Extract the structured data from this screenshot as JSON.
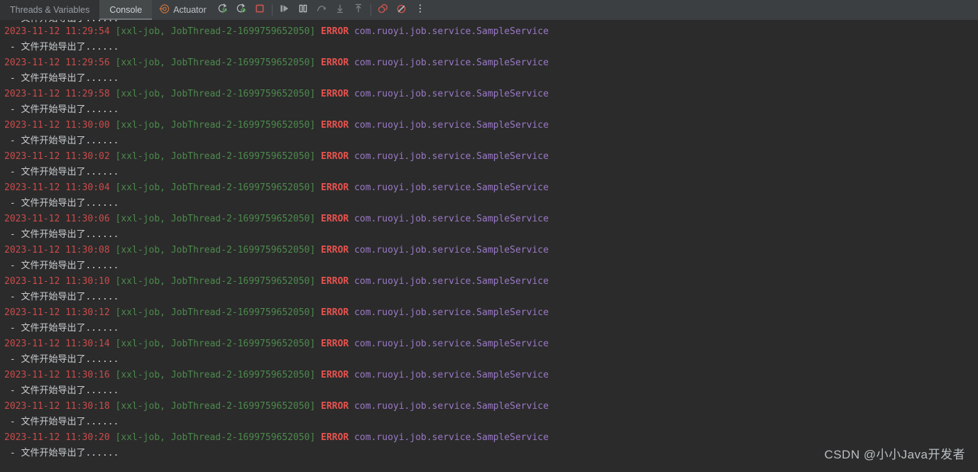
{
  "toolbar": {
    "tabs": [
      {
        "label": "Threads & Variables",
        "active": false
      },
      {
        "label": "Console",
        "active": true
      }
    ],
    "actuator_label": "Actuator",
    "buttons": [
      {
        "name": "rerun-button",
        "title": "Rerun"
      },
      {
        "name": "rerun-debug-button",
        "title": "Rerun Debug"
      },
      {
        "name": "stop-button",
        "title": "Stop"
      },
      {
        "name": "resume-program-button",
        "title": "Resume Program"
      },
      {
        "name": "pause-program-button",
        "title": "Pause Program"
      },
      {
        "name": "step-over-button",
        "title": "Step Over"
      },
      {
        "name": "step-into-button",
        "title": "Step Into"
      },
      {
        "name": "step-out-button",
        "title": "Step Out"
      },
      {
        "name": "view-breakpoints-button",
        "title": "View Breakpoints"
      },
      {
        "name": "mute-breakpoints-button",
        "title": "Mute Breakpoints"
      },
      {
        "name": "more-options-button",
        "title": "More"
      }
    ]
  },
  "console": {
    "colors": {
      "background": "#2b2b2b",
      "toolbar_background": "#3c3f41",
      "timestamp": "#cc4b4b",
      "thread": "#4d8a4d",
      "level": "#e8534f",
      "logger": "#9a79c7",
      "plain_text": "#c8cdd0"
    },
    "info_text": " - 文件开始导出了......",
    "date": "2023-11-12",
    "thread_info": "[xxl-job, JobThread-2-1699759652050]",
    "level": "ERROR",
    "logger": "com.ruoyi.job.service.SampleService",
    "lines": [
      {
        "type": "info",
        "clipped": true
      },
      {
        "type": "error",
        "time": "11:29:54"
      },
      {
        "type": "info"
      },
      {
        "type": "error",
        "time": "11:29:56"
      },
      {
        "type": "info"
      },
      {
        "type": "error",
        "time": "11:29:58"
      },
      {
        "type": "info"
      },
      {
        "type": "error",
        "time": "11:30:00"
      },
      {
        "type": "info"
      },
      {
        "type": "error",
        "time": "11:30:02"
      },
      {
        "type": "info"
      },
      {
        "type": "error",
        "time": "11:30:04"
      },
      {
        "type": "info"
      },
      {
        "type": "error",
        "time": "11:30:06"
      },
      {
        "type": "info"
      },
      {
        "type": "error",
        "time": "11:30:08"
      },
      {
        "type": "info"
      },
      {
        "type": "error",
        "time": "11:30:10"
      },
      {
        "type": "info"
      },
      {
        "type": "error",
        "time": "11:30:12"
      },
      {
        "type": "info"
      },
      {
        "type": "error",
        "time": "11:30:14"
      },
      {
        "type": "info"
      },
      {
        "type": "error",
        "time": "11:30:16"
      },
      {
        "type": "info"
      },
      {
        "type": "error",
        "time": "11:30:18"
      },
      {
        "type": "info"
      },
      {
        "type": "error",
        "time": "11:30:20"
      },
      {
        "type": "info"
      }
    ]
  },
  "watermark": {
    "text": "CSDN @小小Java开发者"
  }
}
